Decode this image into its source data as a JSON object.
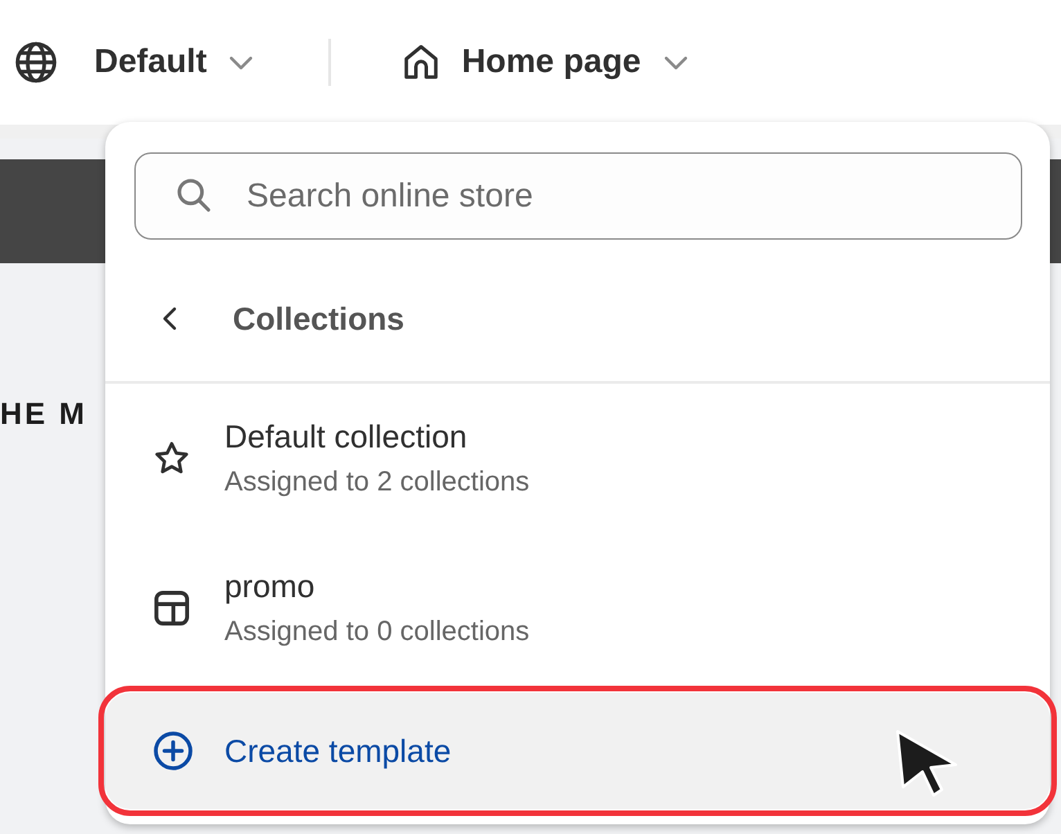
{
  "toolbar": {
    "language": {
      "label": "Default"
    },
    "page": {
      "label": "Home page"
    }
  },
  "preview": {
    "heading": "HE M"
  },
  "dropdown": {
    "search": {
      "placeholder": "Search online store"
    },
    "back": {
      "label": "Collections"
    },
    "items": [
      {
        "kind": "star",
        "title": "Default collection",
        "subtitle": "Assigned to 2 collections"
      },
      {
        "kind": "layout",
        "title": "promo",
        "subtitle": "Assigned to 0 collections"
      }
    ],
    "create": {
      "label": "Create template",
      "highlighted": true
    }
  }
}
